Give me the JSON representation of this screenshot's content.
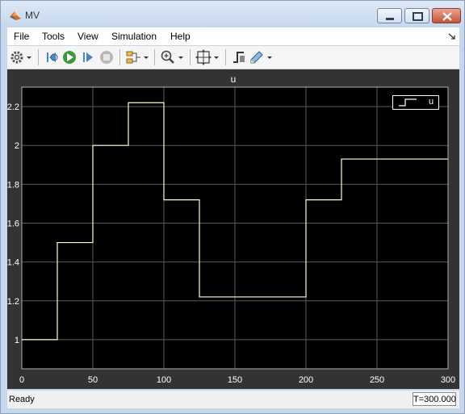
{
  "window": {
    "title": "MV"
  },
  "menu": [
    "File",
    "Tools",
    "View",
    "Simulation",
    "Help"
  ],
  "toolbar": {
    "icons": [
      "gear-icon",
      "step-back-icon",
      "run-icon",
      "step-forward-icon",
      "stop-icon",
      "signal-selector-icon",
      "zoom-icon",
      "autoscale-icon",
      "trigger-icon",
      "style-icon"
    ]
  },
  "colors": {
    "plot_bg": "#000000",
    "frame_bg": "#333333",
    "line": "#ffffcc",
    "grid": "#5a5a5a"
  },
  "chart_data": {
    "type": "line",
    "title": "u",
    "xlim": [
      0,
      300
    ],
    "ylim": [
      0.85,
      2.3
    ],
    "xticks": [
      0,
      50,
      100,
      150,
      200,
      250,
      300
    ],
    "yticks": [
      1,
      1.2,
      1.4,
      1.6,
      1.8,
      2,
      2.2
    ],
    "xtick_labels": [
      "0",
      "50",
      "100",
      "150",
      "200",
      "250",
      "300"
    ],
    "ytick_labels": [
      "1",
      "1.2",
      "1.4",
      "1.6",
      "1.8",
      "2",
      "2.2"
    ],
    "grid": true,
    "legend_position": "top-right",
    "step": true,
    "series": [
      {
        "name": "u",
        "x": [
          0,
          25,
          50,
          75,
          100,
          125,
          150,
          175,
          200,
          225,
          250,
          275,
          300
        ],
        "values": [
          1.0,
          1.5,
          2.0,
          2.22,
          1.72,
          1.22,
          1.22,
          1.22,
          1.72,
          1.93,
          1.93,
          1.93,
          1.93
        ]
      }
    ]
  },
  "status": {
    "left": "Ready",
    "time": "T=300.000"
  }
}
